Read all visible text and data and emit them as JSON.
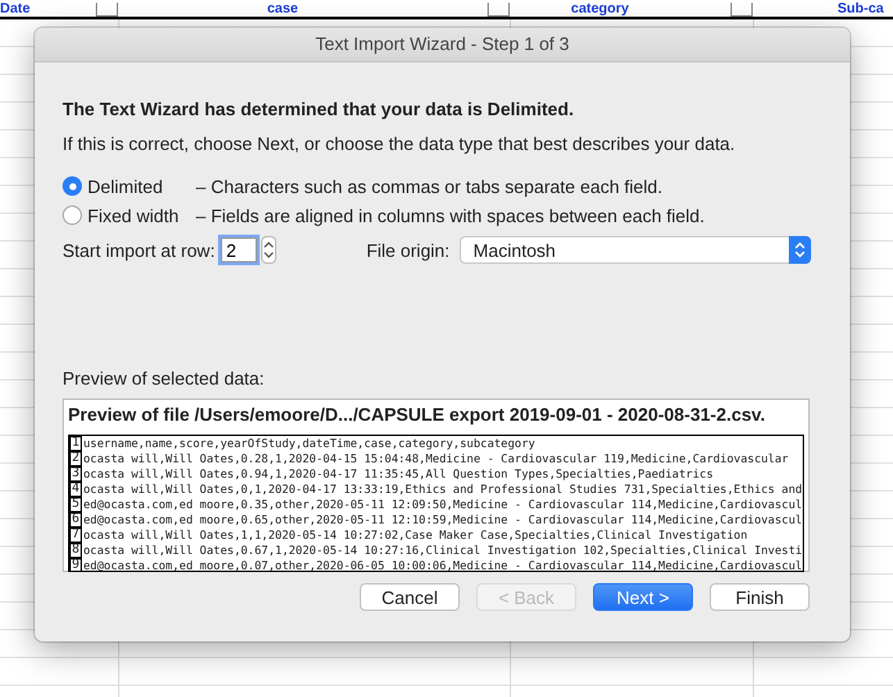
{
  "sheet": {
    "columns": [
      {
        "label": "Date"
      },
      {
        "label": "case"
      },
      {
        "label": "category"
      },
      {
        "label": "Sub-ca"
      }
    ]
  },
  "dialog": {
    "title": "Text Import Wizard - Step 1 of 3",
    "heading": "The Text Wizard has determined that your data is Delimited.",
    "description": "If this is correct, choose Next, or choose the data type that best describes your data.",
    "data_types": [
      {
        "label": "Delimited",
        "description": "– Characters such as commas or tabs separate each field.",
        "selected": true
      },
      {
        "label": "Fixed width",
        "description": "– Fields are aligned in columns with spaces between each field.",
        "selected": false
      }
    ],
    "start_row": {
      "label": "Start import at row:",
      "value": "2"
    },
    "file_origin": {
      "label": "File origin:",
      "value": "Macintosh"
    },
    "preview": {
      "label": "Preview of selected data:",
      "title": "Preview of file /Users/emoore/D.../CAPSULE export 2019-09-01 - 2020-08-31-2.csv.",
      "rows": [
        {
          "number": "1",
          "text": "username,name,score,yearOfStudy,dateTime,case,category,subcategory"
        },
        {
          "number": "2",
          "text": "ocasta will,Will Oates,0.28,1,2020-04-15 15:04:48,Medicine - Cardiovascular 119,Medicine,Cardiovascular"
        },
        {
          "number": "3",
          "text": "ocasta will,Will Oates,0.94,1,2020-04-17 11:35:45,All Question Types,Specialties,Paediatrics"
        },
        {
          "number": "4",
          "text": "ocasta will,Will Oates,0,1,2020-04-17 13:33:19,Ethics and Professional Studies 731,Specialties,Ethics and"
        },
        {
          "number": "5",
          "text": "ed@ocasta.com,ed moore,0.35,other,2020-05-11 12:09:50,Medicine - Cardiovascular 114,Medicine,Cardiovascul"
        },
        {
          "number": "6",
          "text": "ed@ocasta.com,ed moore,0.65,other,2020-05-11 12:10:59,Medicine - Cardiovascular 114,Medicine,Cardiovascul"
        },
        {
          "number": "7",
          "text": "ocasta will,Will Oates,1,1,2020-05-14 10:27:02,Case Maker Case,Specialties,Clinical Investigation"
        },
        {
          "number": "8",
          "text": "ocasta will,Will Oates,0.67,1,2020-05-14 10:27:16,Clinical Investigation 102,Specialties,Clinical Investi"
        },
        {
          "number": "9",
          "text": "ed@ocasta.com,ed moore,0.07,other,2020-06-05 10:00:06,Medicine - Cardiovascular 114,Medicine,Cardiovascul"
        }
      ]
    },
    "buttons": [
      {
        "label": "Cancel",
        "kind": "default",
        "disabled": false
      },
      {
        "label": "< Back",
        "kind": "default",
        "disabled": true
      },
      {
        "label": "Next >",
        "kind": "primary",
        "disabled": false
      },
      {
        "label": "Finish",
        "kind": "default",
        "disabled": false
      }
    ]
  }
}
